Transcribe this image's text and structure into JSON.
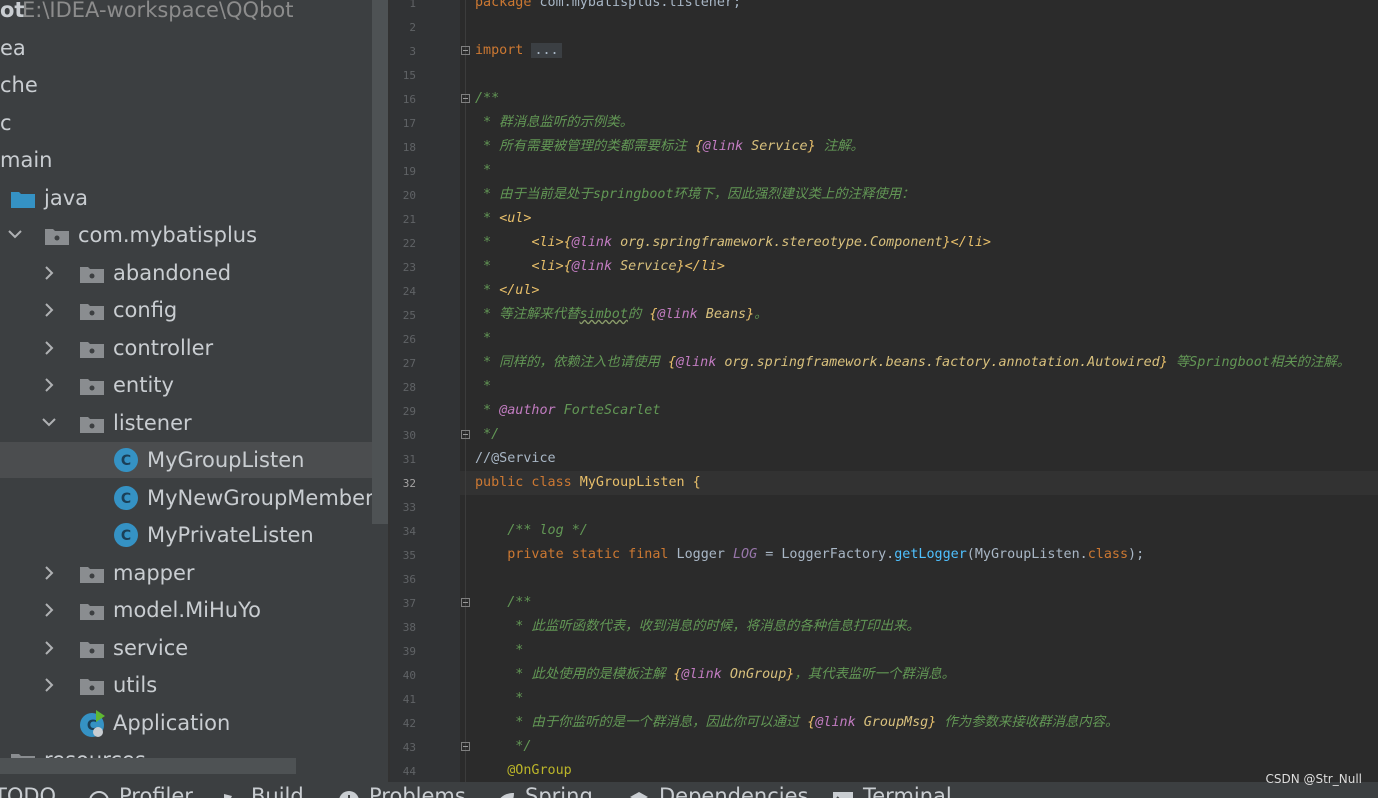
{
  "project_header": {
    "name": "ot",
    "path": "E:\\IDEA-workspace\\QQbot"
  },
  "tree": {
    "items": [
      {
        "label": "ea"
      },
      {
        "label": "che"
      },
      {
        "label": "c"
      },
      {
        "label": "main"
      },
      {
        "label": "java"
      },
      {
        "label": "com.mybatisplus"
      },
      {
        "label": "abandoned"
      },
      {
        "label": "config"
      },
      {
        "label": "controller"
      },
      {
        "label": "entity"
      },
      {
        "label": "listener"
      },
      {
        "label": "MyGroupListen"
      },
      {
        "label": "MyNewGroupMemberListen"
      },
      {
        "label": "MyPrivateListen"
      },
      {
        "label": "mapper"
      },
      {
        "label": "model.MiHuYo"
      },
      {
        "label": "service"
      },
      {
        "label": "utils"
      },
      {
        "label": "Application"
      },
      {
        "label": "resources"
      }
    ]
  },
  "editor": {
    "line_numbers": [
      "1",
      "2",
      "3",
      "15",
      "16",
      "17",
      "18",
      "19",
      "20",
      "21",
      "22",
      "23",
      "24",
      "25",
      "26",
      "27",
      "28",
      "29",
      "30",
      "31",
      "32",
      "33",
      "34",
      "35",
      "36",
      "37",
      "38",
      "39",
      "40",
      "41",
      "42",
      "43",
      "44"
    ],
    "lines": {
      "l1_kw": "package",
      "l1_rest": " com.mybatisplus.listener;",
      "l3_kw": "import",
      "l3_fold": "...",
      "l16": "/**",
      "l17": " * 群消息监听的示例类。",
      "l18_a": " * 所有需要被管理的类都需要标注 ",
      "l18_b": "{",
      "l18_c": "@link",
      "l18_d": " Service",
      "l18_e": "}",
      "l18_f": " 注解。",
      "l19": " *",
      "l20": " * 由于当前是处于springboot环境下，因此强烈建议类上的注释使用：",
      "l21_a": " * ",
      "l21_b": "<ul>",
      "l22_a": " *     ",
      "l22_b": "<li>",
      "l22_c": "{",
      "l22_d": "@link",
      "l22_e": " org.springframework.stereotype.Component",
      "l22_f": "}",
      "l22_g": "</li>",
      "l23_a": " *     ",
      "l23_b": "<li>",
      "l23_c": "{",
      "l23_d": "@link",
      "l23_e": " Service",
      "l23_f": "}",
      "l23_g": "</li>",
      "l24_a": " * ",
      "l24_b": "</ul>",
      "l25_a": " * 等注解来代替",
      "l25_b": "simbot",
      "l25_c": "的 ",
      "l25_d": "{",
      "l25_e": "@link",
      "l25_f": " Beans",
      "l25_g": "}",
      "l25_h": "。",
      "l26": " *",
      "l27_a": " * 同样的，依赖注入也请使用 ",
      "l27_b": "{",
      "l27_c": "@link",
      "l27_d": " org.springframework.beans.factory.annotation.Autowired",
      "l27_e": "}",
      "l27_f": " 等Springboot相关的注解。",
      "l28": " *",
      "l29_a": " * ",
      "l29_b": "@author",
      "l29_c": " ForteScarlet",
      "l30": " */",
      "l31": "//@Service",
      "l32_a": "public class",
      "l32_b": " MyGroupListen {",
      "l34": "    /** log */",
      "l35_a": "    private static final",
      "l35_b": " Logger ",
      "l35_c": "LOG",
      "l35_d": " = LoggerFactory.",
      "l35_e": "getLogger",
      "l35_f": "(MyGroupListen.",
      "l35_g": "class",
      "l35_h": ");",
      "l37": "    /**",
      "l38": "     * 此监听函数代表，收到消息的时候，将消息的各种信息打印出来。",
      "l39": "     *",
      "l40_a": "     * 此处使用的是模板注解 ",
      "l40_b": "{",
      "l40_c": "@link",
      "l40_d": " OnGroup",
      "l40_e": "}",
      "l40_f": "，其代表监听一个群消息。",
      "l41": "     *",
      "l42_a": "     * 由于你监听的是一个群消息，因此你可以通过 ",
      "l42_b": "{",
      "l42_c": "@link",
      "l42_d": " GroupMsg",
      "l42_e": "}",
      "l42_f": " 作为参数来接收群消息内容。",
      "l43": "     */",
      "l44": "    @OnGroup"
    }
  },
  "bottom_tabs": [
    "TODO",
    "Profiler",
    "Build",
    "Problems",
    "Spring",
    "Dependencies",
    "Terminal"
  ],
  "watermark": "CSDN @Str_Null",
  "colors": {
    "background": "#2b2b2b",
    "tree_bg": "#3c3f41",
    "keyword": "#cc7832",
    "doc_comment": "#629755",
    "class_icon": "#3592c4"
  }
}
